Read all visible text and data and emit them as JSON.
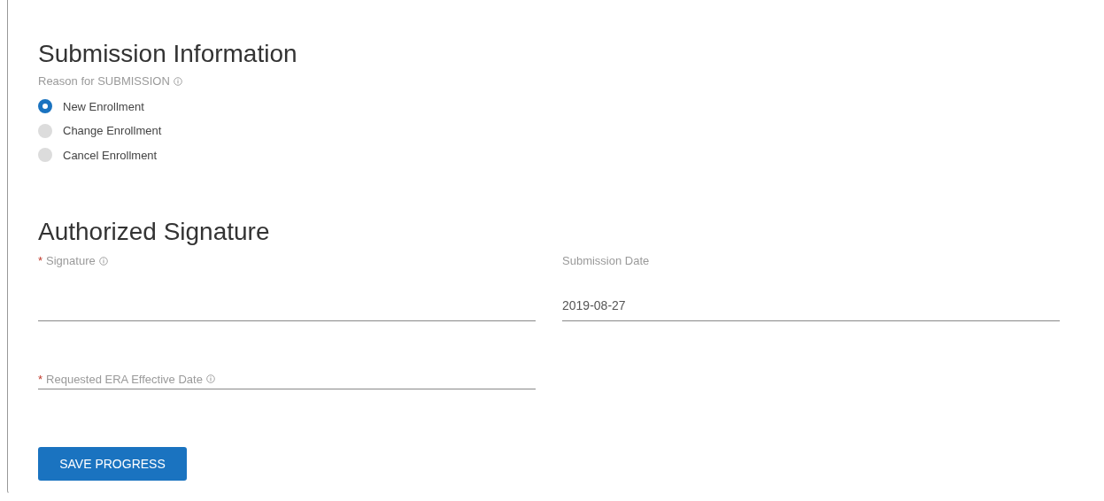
{
  "submission_information": {
    "title": "Submission Information",
    "question": {
      "label": "Reason for SUBMISSION",
      "info": true
    },
    "options": [
      {
        "label": "New Enrollment",
        "selected": true
      },
      {
        "label": "Change Enrollment",
        "selected": false
      },
      {
        "label": "Cancel Enrollment",
        "selected": false
      }
    ]
  },
  "authorized_signature": {
    "title": "Authorized Signature",
    "fields": [
      {
        "kind": "stacked",
        "required_mark": "*",
        "label": "Signature",
        "info": true
      },
      {
        "kind": "stacked",
        "label": "Submission Date",
        "info": false,
        "value": "2019-08-27"
      },
      {
        "kind": "inline",
        "required_mark": "*",
        "label": "Requested ERA Effective Date",
        "info": true
      }
    ]
  },
  "save_button": {
    "label": "SAVE PROGRESS"
  }
}
